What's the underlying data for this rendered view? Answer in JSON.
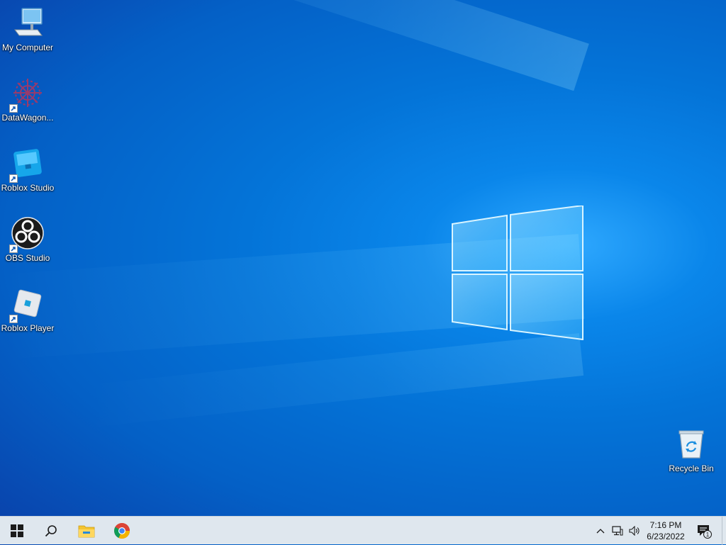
{
  "desktop": {
    "icons": [
      {
        "label": "My Computer",
        "icon": "computer-icon",
        "shortcut": false
      },
      {
        "label": "DataWagon...",
        "icon": "datawagon-icon",
        "shortcut": true
      },
      {
        "label": "Roblox Studio",
        "icon": "roblox-studio-icon",
        "shortcut": true
      },
      {
        "label": "OBS Studio",
        "icon": "obs-studio-icon",
        "shortcut": true
      },
      {
        "label": "Roblox Player",
        "icon": "roblox-player-icon",
        "shortcut": true
      },
      {
        "label": "Recycle Bin",
        "icon": "recycle-bin-icon",
        "shortcut": false
      }
    ]
  },
  "taskbar": {
    "pinned": [
      "start-icon",
      "search-icon",
      "file-explorer-icon",
      "chrome-icon"
    ],
    "tray": [
      "chevron-up-icon",
      "network-icon",
      "volume-icon"
    ],
    "clock": {
      "time": "7:16 PM",
      "date": "6/23/2022"
    },
    "notifications": {
      "count": "1"
    }
  },
  "colors": {
    "accent": "#0078d7",
    "taskbar_bg": "#dfe7ee"
  }
}
